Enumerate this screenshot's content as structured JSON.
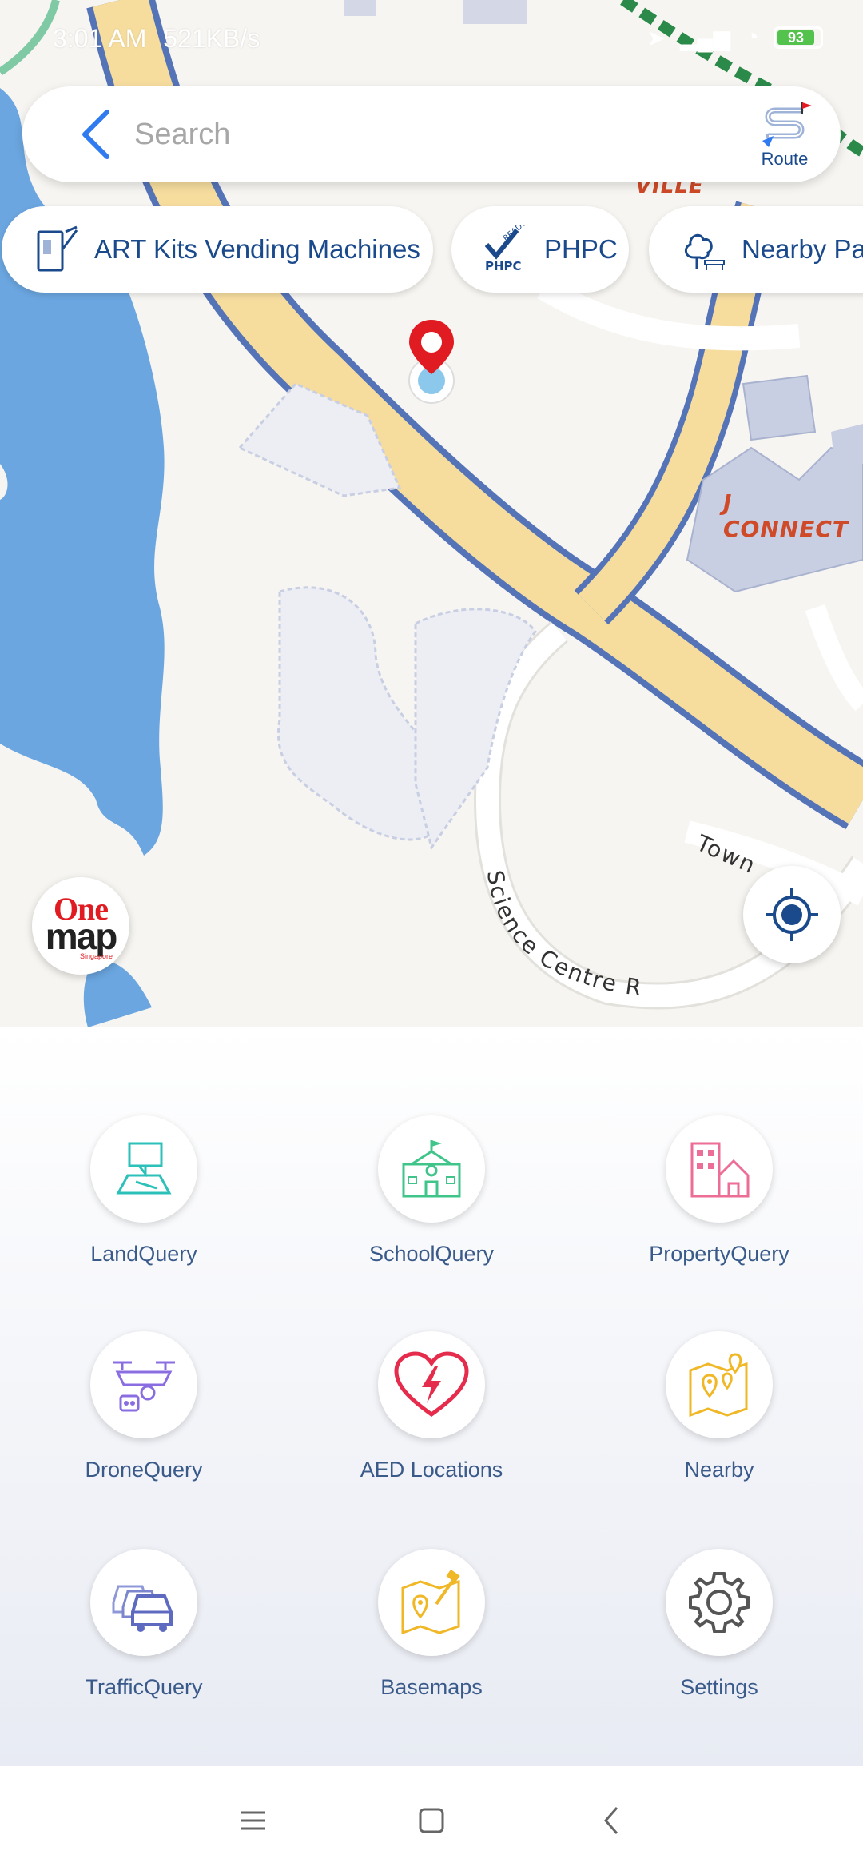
{
  "status_bar": {
    "time": "3:01 AM",
    "speed": "521KB/s",
    "battery": "93"
  },
  "search": {
    "placeholder": "Search",
    "route_label": "Route"
  },
  "chips": [
    {
      "label": "ART Kits Vending Machines",
      "icon": "vending-machine-icon"
    },
    {
      "label": "PHPC",
      "icon": "phpc-ready-icon"
    },
    {
      "label": "Nearby Par",
      "icon": "park-icon"
    }
  ],
  "map": {
    "labels": {
      "ville": "VILLE",
      "jconnect": "J CONNECT",
      "science_centre_rd": "Science Centre Rd",
      "town": "Town"
    },
    "logo": {
      "one": "One",
      "map": "map",
      "sub": "Singapore"
    }
  },
  "colors": {
    "water": "#6ba6e0",
    "road_major": "#f6dd9e",
    "road_outline": "#5574b8",
    "road_minor": "#ffffff",
    "building": "#c9cfe3",
    "accent_blue": "#1a4a8c",
    "pin_red": "#e11b22"
  },
  "menu": [
    {
      "label": "LandQuery",
      "icon": "land-query-icon"
    },
    {
      "label": "SchoolQuery",
      "icon": "school-icon"
    },
    {
      "label": "PropertyQuery",
      "icon": "property-icon"
    },
    {
      "label": "DroneQuery",
      "icon": "drone-icon"
    },
    {
      "label": "AED Locations",
      "icon": "aed-heart-icon"
    },
    {
      "label": "Nearby",
      "icon": "nearby-map-icon"
    },
    {
      "label": "TrafficQuery",
      "icon": "traffic-cars-icon"
    },
    {
      "label": "Basemaps",
      "icon": "basemaps-icon"
    },
    {
      "label": "Settings",
      "icon": "gear-icon"
    }
  ]
}
